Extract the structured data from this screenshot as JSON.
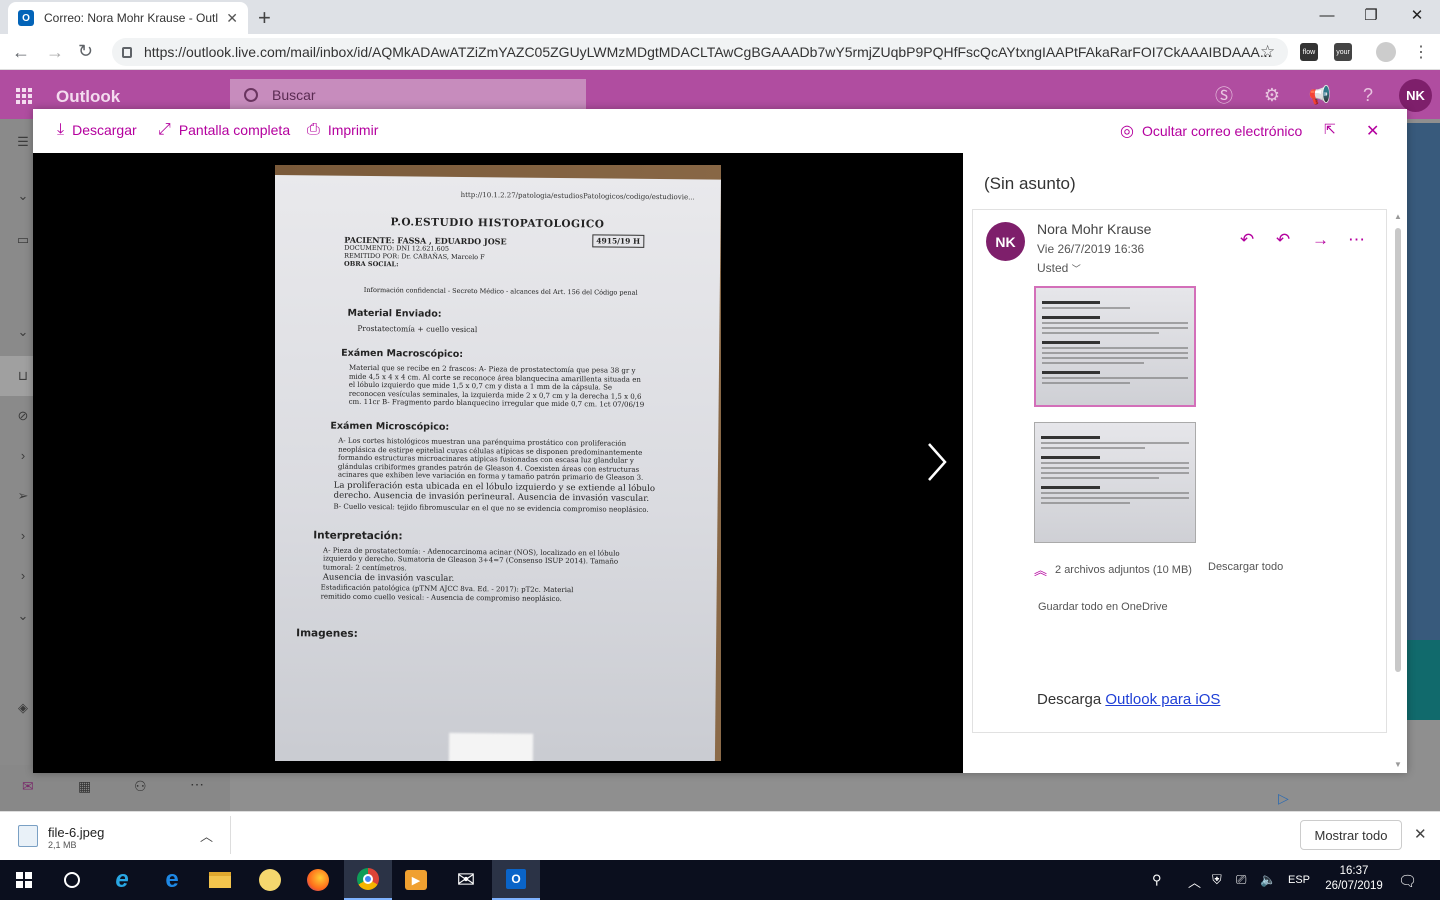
{
  "browser": {
    "tab_title": "Correo: Nora Mohr Krause - Outl",
    "url": "https://outlook.live.com/mail/inbox/id/AQMkADAwATZiZmYAZC05ZGUyLWMzMDgtMDACLTAwCgBGAAADb7wY5rmjZUqbP9PQHfFscQcAYtxngIAAPtFAkaRarFOI7CkAAAIBDAAA...",
    "extensions": [
      "flow",
      "your"
    ]
  },
  "outlook": {
    "brand": "Outlook",
    "search_placeholder": "Buscar",
    "avatar": "NK"
  },
  "viewer": {
    "toolbar": {
      "download": "Descargar",
      "fullscreen": "Pantalla completa",
      "print": "Imprimir",
      "hide_mail": "Ocultar correo electrónico"
    },
    "document": {
      "url_line": "http://10.1.2.27/patologia/estudiosPatologicos/codigo/estudiovie...",
      "title": "P.O.ESTUDIO HISTOPATOLOGICO",
      "case_number": "4915/19 H",
      "patient": "PACIENTE: FASSA , EDUARDO JOSE",
      "document": "DOCUMENTO: DNI 12.621.605",
      "sent_by": "REMITIDO POR: Dr. CABAÑAS, Marcelo F",
      "social": "OBRA SOCIAL:",
      "confidential": "Información confidencial - Secreto Médico - alcances del Art. 156 del Código penal",
      "h_material": "Material Enviado:",
      "material": "Prostatectomía + cuello vesical",
      "h_macro": "Exámen Macroscópico:",
      "macro": "Material que se recibe en 2 frascos: A- Pieza de prostatectomía que pesa 38 gr y mide 4,5 x 4 x 4 cm. Al corte se reconoce área blanquecina amarillenta situada en el lóbulo izquierdo que mide 1,5 x 0,7 cm y dista a 1 mm de la cápsula. Se reconocen vesículas seminales, la izquierda mide 2 x 0,7 cm y la derecha 1,5 x 0,6 cm. 11cr B- Fragmento pardo blanquecino irregular que mide 0,7 cm. 1ct 07/06/19",
      "h_micro": "Exámen Microscópico:",
      "micro": "A- Los cortes histológicos muestran una parénquima prostático con proliferación neoplásica de estirpe epitelial cuyas células atípicas se disponen predominantemente formando estructuras microacinares atípicas fusionadas con escasa luz glandular y glándulas cribiformes grandes patrón de Gleason 4. Coexisten áreas con estructuras acinares que exhiben leve variación en forma y tamaño patrón primario de Gleason 3.",
      "micro2": "La proliferación esta ubicada en el lóbulo izquierdo y se extiende al lóbulo derecho. Ausencia de invasión perineural. Ausencia de invasión vascular.",
      "micro3": "B- Cuello vesical: tejido fibromuscular en el que no se evidencia compromiso neoplásico.",
      "h_interp": "Interpretación:",
      "interp": "A- Pieza de prostatectomía: - Adenocarcinoma acinar (NOS), localizado en el lóbulo izquierdo y derecho. Sumatoria de Gleason 3+4=7 (Consenso ISUP 2014). Tamaño tumoral: 2 centímetros.",
      "interp2": "Ausencia de invasión vascular.",
      "interp3": "Estadificación patológica (pTNM AJCC 8va. Ed. - 2017): pT2c. Material remitido como cuello vesical: - Ausencia de compromiso neoplásico.",
      "h_images": "Imagenes:"
    }
  },
  "message": {
    "subject": "(Sin asunto)",
    "avatar": "NK",
    "sender": "Nora Mohr Krause",
    "date": "Vie 26/7/2019 16:36",
    "to": "Usted",
    "attachments_info": "2 archivos adjuntos (10 MB)",
    "download_all": "Descargar todo",
    "save_onedrive": "Guardar todo en OneDrive",
    "footer_text": "Descarga ",
    "footer_link": "Outlook para iOS"
  },
  "downloads": {
    "file_name": "file-6.jpeg",
    "file_size": "2,1 MB",
    "show_all": "Mostrar todo"
  },
  "taskbar": {
    "lang": "ESP",
    "time": "16:37",
    "date": "26/07/2019"
  }
}
